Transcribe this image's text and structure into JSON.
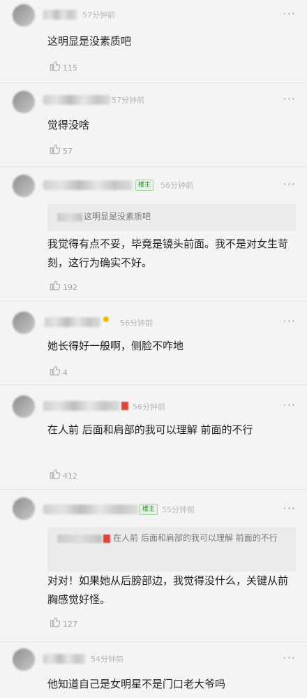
{
  "more_label": "···",
  "colors": {
    "badge_green": "#2a8a2a",
    "accent_red": "#d9463c",
    "muted": "#b5b5b5"
  },
  "comments": [
    {
      "time": "57分钟前",
      "text": "这明显是没素质吧",
      "likes": "115"
    },
    {
      "time": "57分钟前",
      "text": "觉得没啥",
      "likes": "57"
    },
    {
      "badge": "楼主",
      "time": "56分钟前",
      "quote": "这明显是没素质吧",
      "text": "我觉得有点不妥，毕竟是镜头前面。我不是对女生苛刻，这行为确实不好。",
      "likes": "192"
    },
    {
      "time": "56分钟前",
      "text": "她长得好一般啊，侧脸不咋地",
      "likes": "4"
    },
    {
      "time": "56分钟前",
      "text": "在人前 后面和肩部的我可以理解 前面的不行",
      "likes": "412"
    },
    {
      "badge": "楼主",
      "time": "55分钟前",
      "quote": "在人前 后面和肩部的我可以理解 前面的不行",
      "text": "对对！如果她从后膀部边，我觉得没什么，关键从前胸感觉好怪。",
      "likes": "127"
    },
    {
      "time": "54分钟前",
      "text": "他知道自己是女明星不是门口老大爷吗"
    }
  ]
}
